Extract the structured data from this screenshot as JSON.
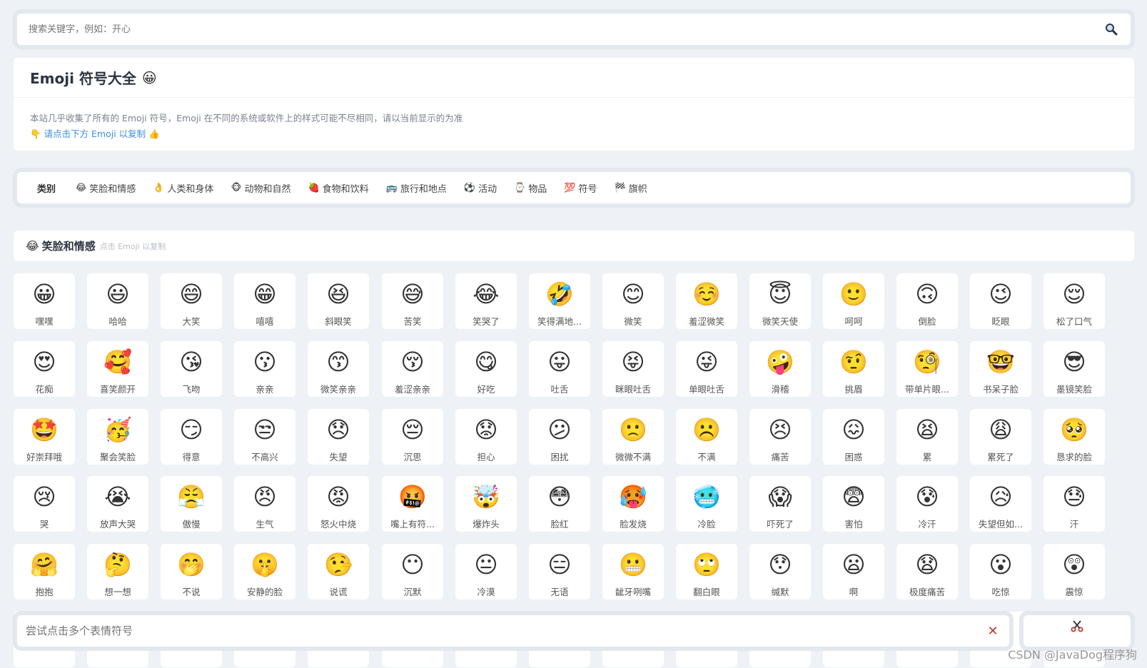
{
  "search": {
    "placeholder": "搜索关键字，例如：开心"
  },
  "intro": {
    "title": "Emoji 符号大全",
    "title_emoji": "😀",
    "description": "本站几乎收集了所有的 Emoji 符号，Emoji 在不同的系统或软件上的样式可能不尽相同，请以当前显示的为准",
    "hint_left_emoji": "👇",
    "hint": "请点击下方 Emoji 以复制",
    "hint_right_emoji": "👍"
  },
  "categories": {
    "label": "类别",
    "items": [
      {
        "emoji": "😂",
        "label": "笑脸和情感"
      },
      {
        "emoji": "👌",
        "label": "人类和身体"
      },
      {
        "emoji": "🐵",
        "label": "动物和自然"
      },
      {
        "emoji": "🍓",
        "label": "食物和饮料"
      },
      {
        "emoji": "🚌",
        "label": "旅行和地点"
      },
      {
        "emoji": "⚽",
        "label": "活动"
      },
      {
        "emoji": "⌚",
        "label": "物品"
      },
      {
        "emoji": "💯",
        "label": "符号"
      },
      {
        "emoji": "🏁",
        "label": "旗帜"
      }
    ]
  },
  "section": {
    "emoji": "😂",
    "title": "笑脸和情感",
    "subtitle": "点击 Emoji 以复制"
  },
  "emojis": [
    [
      {
        "e": "😀",
        "n": "嘿嘿"
      },
      {
        "e": "😃",
        "n": "哈哈"
      },
      {
        "e": "😄",
        "n": "大笑"
      },
      {
        "e": "😁",
        "n": "嘻嘻"
      },
      {
        "e": "😆",
        "n": "斜眼笑"
      },
      {
        "e": "😅",
        "n": "苦笑"
      },
      {
        "e": "😂",
        "n": "笑哭了"
      },
      {
        "e": "🤣",
        "n": "笑得满地..."
      },
      {
        "e": "😊",
        "n": "微笑"
      },
      {
        "e": "☺️",
        "n": "羞涩微笑"
      },
      {
        "e": "😇",
        "n": "微笑天使"
      },
      {
        "e": "🙂",
        "n": "呵呵"
      },
      {
        "e": "🙃",
        "n": "倒脸"
      },
      {
        "e": "😉",
        "n": "眨眼"
      },
      {
        "e": "😌",
        "n": "松了口气"
      }
    ],
    [
      {
        "e": "😍",
        "n": "花痴"
      },
      {
        "e": "🥰",
        "n": "喜笑颜开"
      },
      {
        "e": "😘",
        "n": "飞吻"
      },
      {
        "e": "😗",
        "n": "亲亲"
      },
      {
        "e": "😙",
        "n": "微笑亲亲"
      },
      {
        "e": "😚",
        "n": "羞涩亲亲"
      },
      {
        "e": "😋",
        "n": "好吃"
      },
      {
        "e": "😛",
        "n": "吐舌"
      },
      {
        "e": "😝",
        "n": "眯眼吐舌"
      },
      {
        "e": "😜",
        "n": "单眼吐舌"
      },
      {
        "e": "🤪",
        "n": "滑稽"
      },
      {
        "e": "🤨",
        "n": "挑眉"
      },
      {
        "e": "🧐",
        "n": "带单片眼..."
      },
      {
        "e": "🤓",
        "n": "书呆子脸"
      },
      {
        "e": "😎",
        "n": "墨镜笑脸"
      }
    ],
    [
      {
        "e": "🤩",
        "n": "好崇拜哦"
      },
      {
        "e": "🥳",
        "n": "聚会笑脸"
      },
      {
        "e": "😏",
        "n": "得意"
      },
      {
        "e": "😒",
        "n": "不高兴"
      },
      {
        "e": "😞",
        "n": "失望"
      },
      {
        "e": "😔",
        "n": "沉思"
      },
      {
        "e": "😟",
        "n": "担心"
      },
      {
        "e": "😕",
        "n": "困扰"
      },
      {
        "e": "🙁",
        "n": "微微不满"
      },
      {
        "e": "☹️",
        "n": "不满"
      },
      {
        "e": "😣",
        "n": "痛苦"
      },
      {
        "e": "😖",
        "n": "困惑"
      },
      {
        "e": "😫",
        "n": "累"
      },
      {
        "e": "😩",
        "n": "累死了"
      },
      {
        "e": "🥺",
        "n": "恳求的脸"
      }
    ],
    [
      {
        "e": "😢",
        "n": "哭"
      },
      {
        "e": "😭",
        "n": "放声大哭"
      },
      {
        "e": "😤",
        "n": "傲慢"
      },
      {
        "e": "😠",
        "n": "生气"
      },
      {
        "e": "😡",
        "n": "怒火中烧"
      },
      {
        "e": "🤬",
        "n": "嘴上有符..."
      },
      {
        "e": "🤯",
        "n": "爆炸头"
      },
      {
        "e": "😳",
        "n": "脸红"
      },
      {
        "e": "🥵",
        "n": "脸发烧"
      },
      {
        "e": "🥶",
        "n": "冷脸"
      },
      {
        "e": "😱",
        "n": "吓死了"
      },
      {
        "e": "😨",
        "n": "害怕"
      },
      {
        "e": "😰",
        "n": "冷汗"
      },
      {
        "e": "😥",
        "n": "失望但如..."
      },
      {
        "e": "😓",
        "n": "汗"
      }
    ],
    [
      {
        "e": "🤗",
        "n": "抱抱"
      },
      {
        "e": "🤔",
        "n": "想一想"
      },
      {
        "e": "🤭",
        "n": "不说"
      },
      {
        "e": "🤫",
        "n": "安静的脸"
      },
      {
        "e": "🤥",
        "n": "说谎"
      },
      {
        "e": "😶",
        "n": "沉默"
      },
      {
        "e": "😐",
        "n": "冷漠"
      },
      {
        "e": "😑",
        "n": "无语"
      },
      {
        "e": "😬",
        "n": "龇牙咧嘴"
      },
      {
        "e": "🙄",
        "n": "翻白眼"
      },
      {
        "e": "😯",
        "n": "缄默"
      },
      {
        "e": "😦",
        "n": "啊"
      },
      {
        "e": "😧",
        "n": "极度痛苦"
      },
      {
        "e": "😮",
        "n": "吃惊"
      },
      {
        "e": "😲",
        "n": "震惊"
      }
    ],
    [
      {
        "e": "🥱",
        "n": ""
      },
      {
        "e": "😴",
        "n": ""
      },
      {
        "e": "🤤",
        "n": ""
      },
      {
        "e": "😪",
        "n": ""
      },
      {
        "e": "😵",
        "n": ""
      },
      {
        "e": "🤐",
        "n": ""
      },
      {
        "e": "🥴",
        "n": ""
      },
      {
        "e": "🤢",
        "n": ""
      },
      {
        "e": "🤮",
        "n": ""
      },
      {
        "e": "🤧",
        "n": ""
      },
      {
        "e": "😷",
        "n": ""
      },
      {
        "e": "🤒",
        "n": ""
      },
      {
        "e": "🤕",
        "n": ""
      },
      {
        "e": "🤑",
        "n": ""
      },
      {
        "e": "🤠",
        "n": ""
      }
    ]
  ],
  "copy_bar": {
    "placeholder": "尝试点击多个表情符号",
    "clear_icon": "close-icon",
    "copy_icon": "scissors-icon"
  },
  "watermark": "CSDN @JavaDog程序狗"
}
